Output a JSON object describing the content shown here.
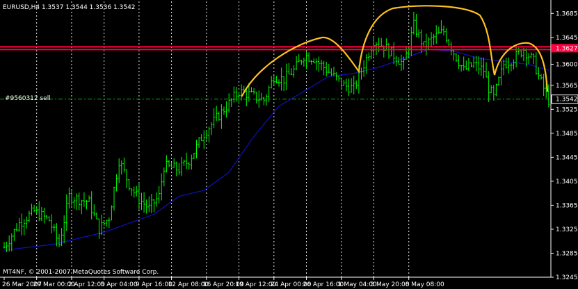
{
  "chart_data": {
    "type": "candlestick",
    "symbol_header": "EURUSD,H4  1.3537 1.3544 1.3536 1.3542",
    "copyright": "MT4NF, © 2001-2007 MetaQuotes Software Corp.",
    "order_label": "#9560312 sell",
    "ylim": [
      1.3245,
      1.3705
    ],
    "y_ticks": [
      "1.3685",
      "1.3645",
      "1.3600",
      "1.3565",
      "1.3525",
      "1.3485",
      "1.3445",
      "1.3405",
      "1.3365",
      "1.3325",
      "1.3285",
      "1.3245"
    ],
    "y_tick_values": [
      1.3685,
      1.3645,
      1.36,
      1.3565,
      1.3525,
      1.3485,
      1.3445,
      1.3405,
      1.3365,
      1.3325,
      1.3285,
      1.3245
    ],
    "x_ticks": [
      "26 Mar 2007",
      "29 Mar 00:00",
      "2 Apr 12:00",
      "5 Apr 04:00",
      "9 Apr 16:00",
      "12 Apr 08:00",
      "16 Apr 20:00",
      "19 Apr 12:00",
      "24 Apr 00:00",
      "26 Apr 16:00",
      "1 May 04:00",
      "3 May 20:00",
      "8 May 08:00"
    ],
    "x_tick_index": [
      0,
      13,
      27,
      40,
      54,
      67,
      81,
      94,
      108,
      121,
      135,
      148,
      162
    ],
    "resistance_level": 1.3627,
    "resistance_label": "1.3627",
    "current_price": 1.3542,
    "current_price_label": "1.3542",
    "order_level": 1.3542,
    "grid": true,
    "colors": {
      "background": "#000000",
      "candle": "#00ff00",
      "moving_average": "#1010c0",
      "resistance": "#ff0040",
      "pattern_curve": "#ffc020",
      "order_line": "#00c000",
      "grid": "#ffffff"
    },
    "close_path": [
      [
        0,
        1.3295
      ],
      [
        6,
        1.3335
      ],
      [
        12,
        1.3355
      ],
      [
        18,
        1.334
      ],
      [
        22,
        1.33
      ],
      [
        26,
        1.338
      ],
      [
        34,
        1.337
      ],
      [
        38,
        1.3325
      ],
      [
        42,
        1.3345
      ],
      [
        46,
        1.344
      ],
      [
        50,
        1.34
      ],
      [
        54,
        1.3375
      ],
      [
        58,
        1.336
      ],
      [
        62,
        1.338
      ],
      [
        64,
        1.343
      ],
      [
        70,
        1.3425
      ],
      [
        74,
        1.344
      ],
      [
        80,
        1.3485
      ],
      [
        84,
        1.3505
      ],
      [
        88,
        1.3525
      ],
      [
        94,
        1.3555
      ],
      [
        98,
        1.355
      ],
      [
        104,
        1.354
      ],
      [
        108,
        1.358
      ],
      [
        112,
        1.3575
      ],
      [
        116,
        1.359
      ],
      [
        120,
        1.3615
      ],
      [
        124,
        1.361
      ],
      [
        128,
        1.3595
      ],
      [
        132,
        1.358
      ],
      [
        136,
        1.3565
      ],
      [
        140,
        1.356
      ],
      [
        144,
        1.36
      ],
      [
        148,
        1.364
      ],
      [
        152,
        1.363
      ],
      [
        156,
        1.3615
      ],
      [
        160,
        1.36
      ],
      [
        164,
        1.3665
      ],
      [
        168,
        1.363
      ],
      [
        172,
        1.3645
      ],
      [
        176,
        1.3655
      ],
      [
        180,
        1.362
      ],
      [
        184,
        1.359
      ],
      [
        188,
        1.36
      ],
      [
        192,
        1.359
      ],
      [
        194,
        1.356
      ],
      [
        196,
        1.3545
      ],
      [
        200,
        1.36
      ],
      [
        204,
        1.361
      ],
      [
        208,
        1.3625
      ],
      [
        212,
        1.3605
      ],
      [
        214,
        1.358
      ],
      [
        216,
        1.356
      ],
      [
        218,
        1.354
      ]
    ],
    "ma_path": [
      [
        0,
        1.329
      ],
      [
        20,
        1.33
      ],
      [
        40,
        1.332
      ],
      [
        60,
        1.335
      ],
      [
        70,
        1.338
      ],
      [
        80,
        1.339
      ],
      [
        90,
        1.342
      ],
      [
        100,
        1.348
      ],
      [
        110,
        1.353
      ],
      [
        120,
        1.3555
      ],
      [
        130,
        1.358
      ],
      [
        140,
        1.3585
      ],
      [
        150,
        1.3595
      ],
      [
        160,
        1.361
      ],
      [
        170,
        1.3625
      ],
      [
        180,
        1.3622
      ],
      [
        190,
        1.361
      ],
      [
        200,
        1.3605
      ],
      [
        210,
        1.36
      ],
      [
        218,
        1.359
      ]
    ]
  }
}
